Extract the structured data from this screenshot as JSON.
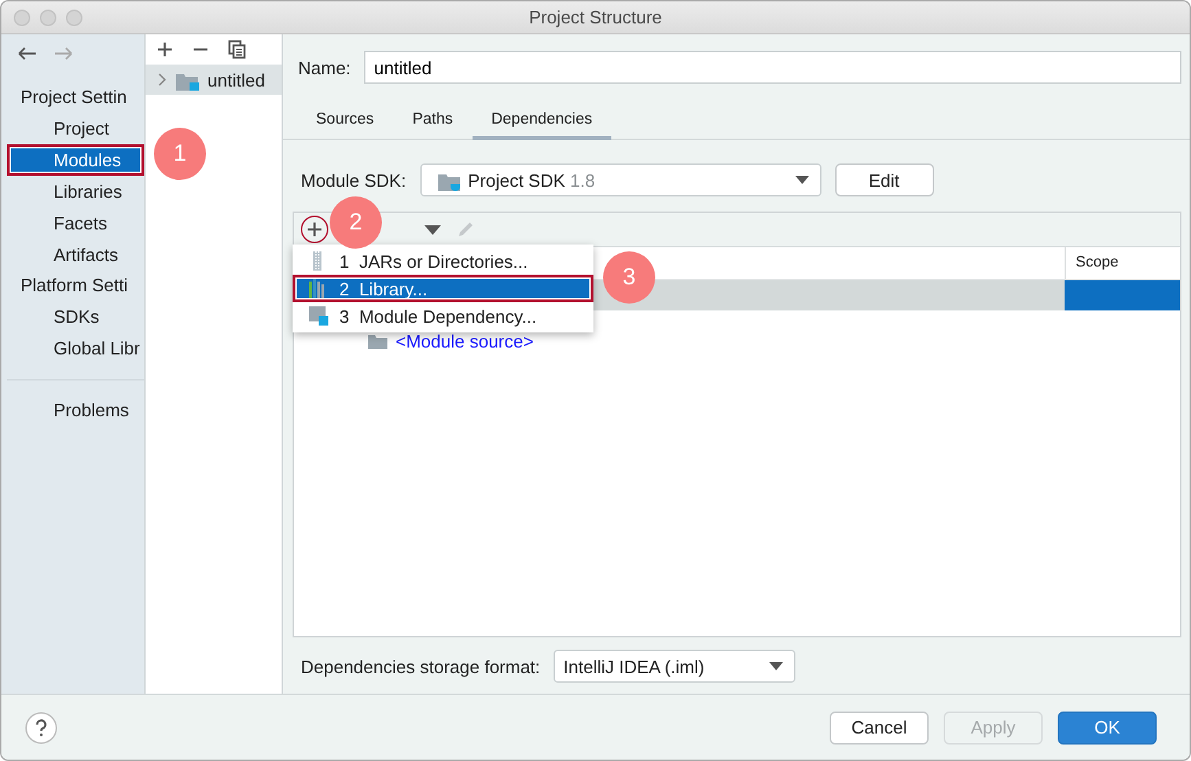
{
  "window": {
    "title": "Project Structure"
  },
  "sidebar": {
    "sections": [
      {
        "header": "Project Settin",
        "items": [
          {
            "label": "Project",
            "selected": false,
            "highlighted": false
          },
          {
            "label": "Modules",
            "selected": true,
            "highlighted": true
          },
          {
            "label": "Libraries",
            "selected": false,
            "highlighted": false
          },
          {
            "label": "Facets",
            "selected": false,
            "highlighted": false
          },
          {
            "label": "Artifacts",
            "selected": false,
            "highlighted": false
          }
        ]
      },
      {
        "header": "Platform Setti",
        "items": [
          {
            "label": "SDKs",
            "selected": false,
            "highlighted": false
          },
          {
            "label": "Global Libr",
            "selected": false,
            "highlighted": false
          }
        ]
      }
    ],
    "footer_items": [
      {
        "label": "Problems",
        "selected": false,
        "highlighted": false
      }
    ]
  },
  "module_tree": {
    "items": [
      {
        "label": "untitled",
        "selected": true,
        "expanded": false
      }
    ]
  },
  "name_field": {
    "label": "Name:",
    "value": "untitled"
  },
  "tabs": [
    {
      "label": "Sources",
      "selected": false
    },
    {
      "label": "Paths",
      "selected": false
    },
    {
      "label": "Dependencies",
      "selected": true
    }
  ],
  "module_sdk": {
    "label": "Module SDK:",
    "value": "Project SDK",
    "version": "1.8",
    "edit_button": "Edit"
  },
  "dependencies": {
    "add_highlighted": true,
    "scope_header": "Scope",
    "rows": [
      {
        "selected": true
      },
      {
        "text": "<Module source>",
        "selected": false
      }
    ]
  },
  "add_menu": {
    "items": [
      {
        "kind": "jars",
        "number": "1",
        "label": "JARs or Directories...",
        "selected": false,
        "highlighted": false
      },
      {
        "kind": "library",
        "number": "2",
        "label": "Library...",
        "selected": true,
        "highlighted": true
      },
      {
        "kind": "module",
        "number": "3",
        "label": "Module Dependency...",
        "selected": false,
        "highlighted": false
      }
    ]
  },
  "storage_format": {
    "label": "Dependencies storage format:",
    "value": "IntelliJ IDEA (.iml)"
  },
  "buttons": [
    {
      "kind": "normal",
      "label": "Cancel",
      "disabled": false
    },
    {
      "kind": "normal",
      "label": "Apply",
      "disabled": true
    },
    {
      "kind": "default",
      "label": "OK",
      "disabled": false
    }
  ],
  "callouts": [
    {
      "label": "1"
    },
    {
      "label": "2"
    },
    {
      "label": "3"
    }
  ]
}
